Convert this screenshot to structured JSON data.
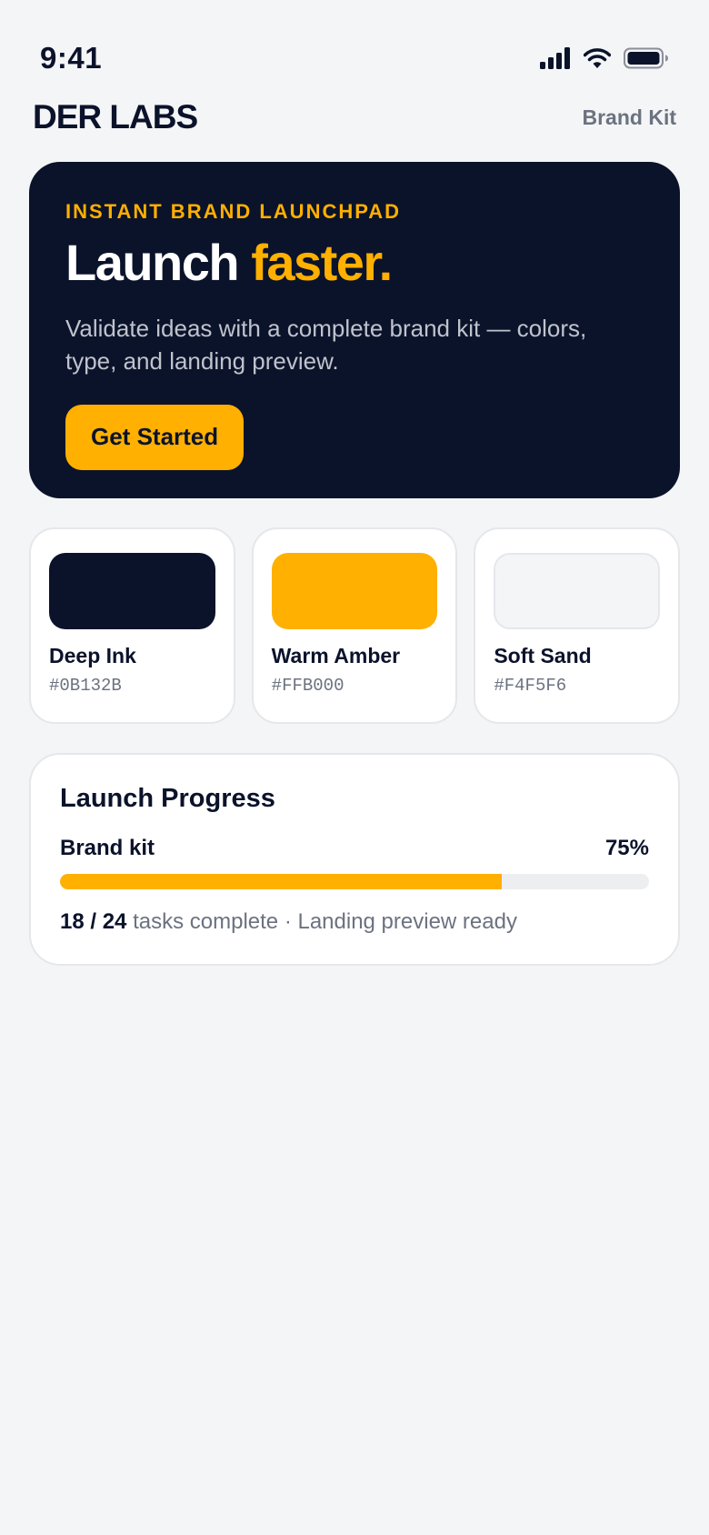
{
  "status_bar": {
    "time": "9:41",
    "icons": [
      "cellular-signal-icon",
      "wifi-icon",
      "battery-icon"
    ]
  },
  "header": {
    "brand": "DER LABS",
    "link_label": "Brand Kit"
  },
  "hero": {
    "eyebrow": "INSTANT BRAND LAUNCHPAD",
    "title_main": "Launch",
    "title_accent": "faster.",
    "description": "Validate ideas with a complete brand kit — colors, type, and landing preview.",
    "cta_label": "Get Started"
  },
  "swatches": [
    {
      "name": "Deep Ink",
      "hex": "#0B132B",
      "color": "#0B132B"
    },
    {
      "name": "Warm Amber",
      "hex": "#FFB000",
      "color": "#FFB000"
    },
    {
      "name": "Soft Sand",
      "hex": "#F4F5F6",
      "color": "#F4F5F6"
    }
  ],
  "progress": {
    "title": "Launch Progress",
    "label": "Brand kit",
    "percent_text": "75%",
    "fraction": 0.75,
    "tasks_count": "18 / 24",
    "tasks_text": "tasks complete · Landing preview ready"
  },
  "colors": {
    "ink": "#0B132B",
    "amber": "#FFB000",
    "sand": "#F4F5F6",
    "muted": "#6B7280"
  }
}
